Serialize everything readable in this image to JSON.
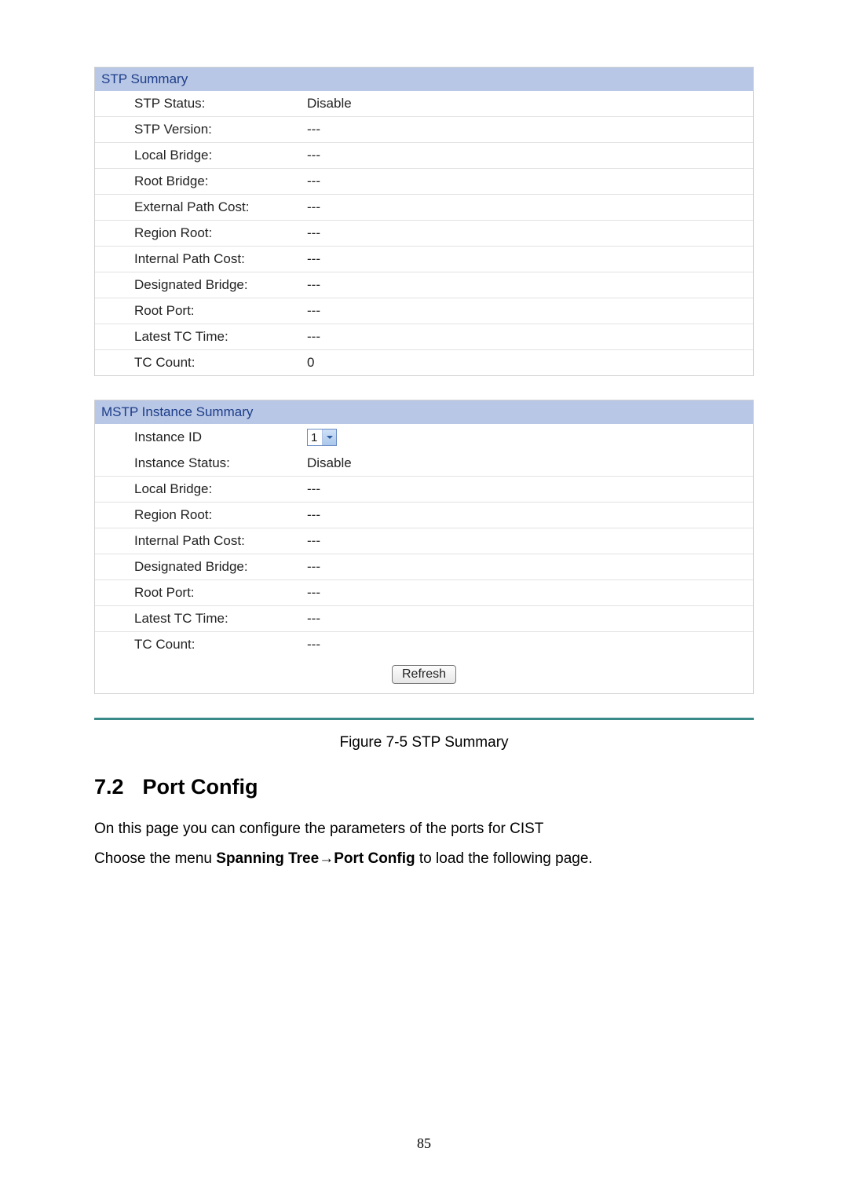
{
  "stp_summary": {
    "title": "STP Summary",
    "rows": [
      {
        "label": "STP Status:",
        "value": "Disable"
      },
      {
        "label": "STP Version:",
        "value": "---"
      },
      {
        "label": "Local Bridge:",
        "value": "---"
      },
      {
        "label": "Root Bridge:",
        "value": "---"
      },
      {
        "label": "External Path Cost:",
        "value": "---"
      },
      {
        "label": "Region Root:",
        "value": "---"
      },
      {
        "label": "Internal Path Cost:",
        "value": "---"
      },
      {
        "label": "Designated Bridge:",
        "value": "---"
      },
      {
        "label": "Root Port:",
        "value": "---"
      },
      {
        "label": "Latest TC Time:",
        "value": "---"
      },
      {
        "label": "TC Count:",
        "value": "0"
      }
    ]
  },
  "mstp_summary": {
    "title": "MSTP Instance Summary",
    "instance_id_label": "Instance ID",
    "instance_id_value": "1",
    "rows": [
      {
        "label": "Instance Status:",
        "value": "Disable"
      },
      {
        "label": "Local Bridge:",
        "value": "---"
      },
      {
        "label": "Region Root:",
        "value": "---"
      },
      {
        "label": "Internal Path Cost:",
        "value": "---"
      },
      {
        "label": "Designated Bridge:",
        "value": "---"
      },
      {
        "label": "Root Port:",
        "value": "---"
      },
      {
        "label": "Latest TC Time:",
        "value": "---"
      },
      {
        "label": "TC Count:",
        "value": "---"
      }
    ]
  },
  "refresh_label": "Refresh",
  "figure_caption": "Figure 7-5 STP Summary",
  "section_number": "7.2",
  "section_title": "Port Config",
  "body_line1": "On this page you can configure the parameters of the ports for CIST",
  "body_line2_pre": "Choose the menu ",
  "body_line2_b1": "Spanning Tree",
  "body_line2_arrow": "→",
  "body_line2_b2": "Port Config",
  "body_line2_post": " to load the following page.",
  "page_number": "85"
}
